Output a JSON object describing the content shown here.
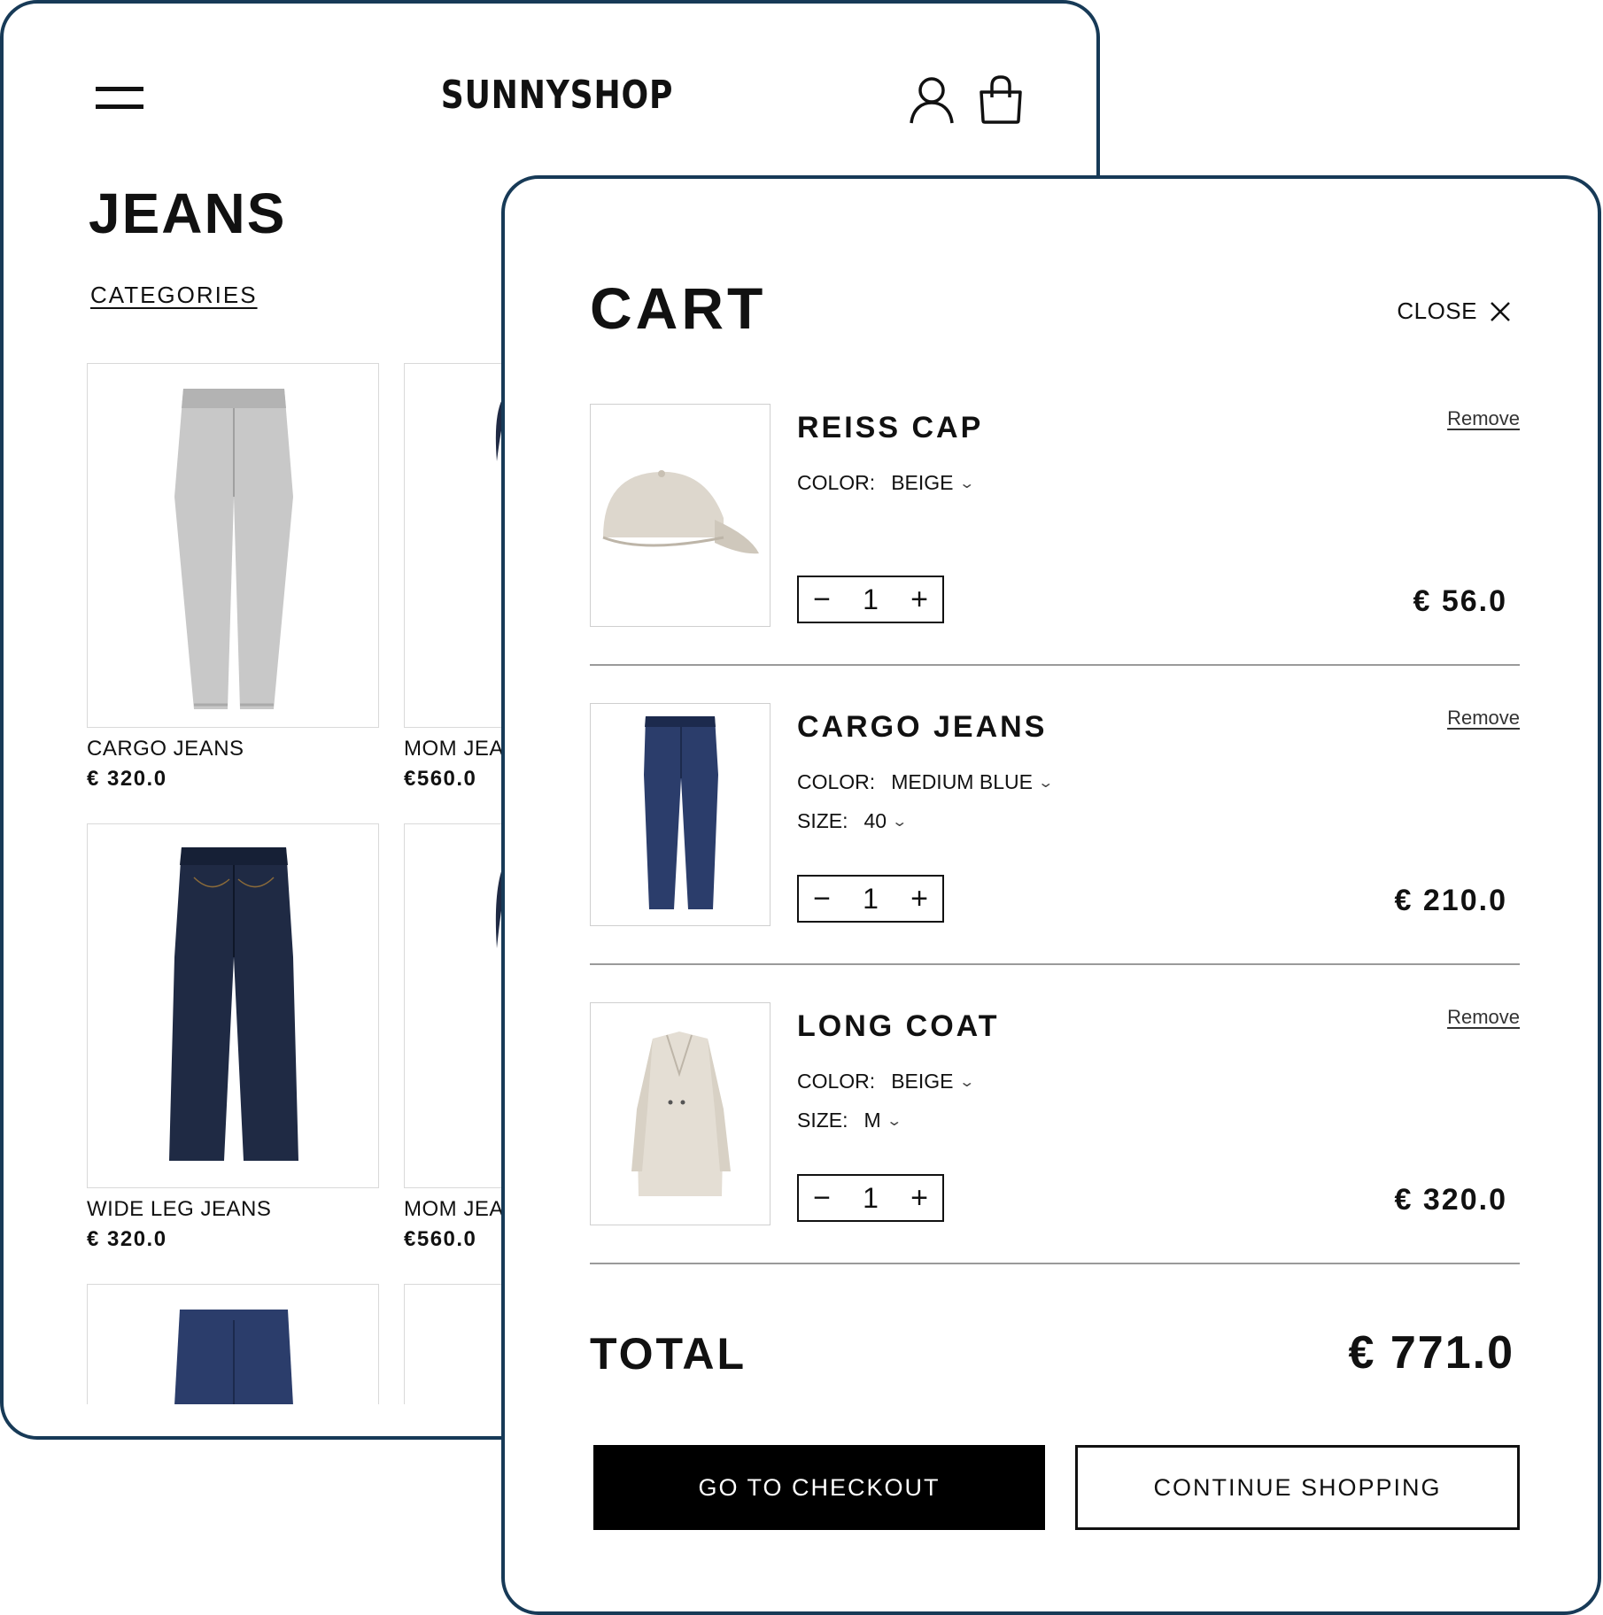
{
  "shop": {
    "logo": "SUNNYSHOP",
    "page_title": "JEANS",
    "categories_link": "CATEGORIES",
    "products": [
      {
        "name": "CARGO JEANS",
        "price": "€ 320.0"
      },
      {
        "name": "MOM JEA",
        "price": "€560.0"
      },
      {
        "name": "WIDE LEG JEANS",
        "price": "€ 320.0"
      },
      {
        "name": "MOM JEA",
        "price": "€560.0"
      }
    ]
  },
  "cart": {
    "title": "CART",
    "close_label": "CLOSE",
    "items": [
      {
        "name": "REISS CAP",
        "remove_label": "Remove",
        "color_label": "COLOR:",
        "color": "BEIGE",
        "quantity": "1",
        "price": "€ 56.0"
      },
      {
        "name": "CARGO JEANS",
        "remove_label": "Remove",
        "color_label": "COLOR:",
        "color": "MEDIUM BLUE",
        "size_label": "SIZE:",
        "size": "40",
        "quantity": "1",
        "price": "€ 210.0"
      },
      {
        "name": "LONG COAT",
        "remove_label": "Remove",
        "color_label": "COLOR:",
        "color": "BEIGE",
        "size_label": "SIZE:",
        "size": "M",
        "quantity": "1",
        "price": "€ 320.0"
      }
    ],
    "total_label": "TOTAL",
    "total_value": "€ 771.0",
    "checkout_label": "GO TO CHECKOUT",
    "continue_label": "CONTINUE SHOPPING"
  },
  "colors": {
    "frame_border": "#173a57",
    "primary_button": "#000000",
    "grey_denim": "#c8c8c8",
    "dark_denim": "#1f2a44",
    "medium_denim": "#2b3d6b",
    "beige": "#e4ded4"
  },
  "icons": [
    "hamburger-icon",
    "account-icon",
    "shopping-bag-icon",
    "close-icon",
    "chevron-down-icon",
    "minus-icon",
    "plus-icon"
  ]
}
